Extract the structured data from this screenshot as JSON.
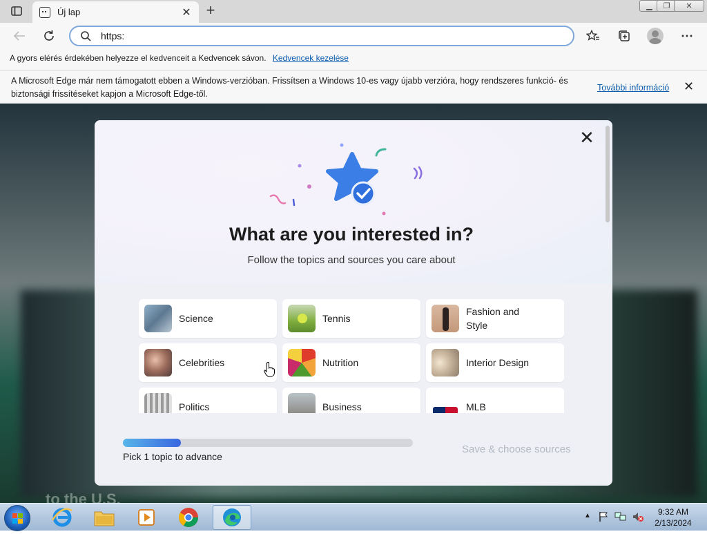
{
  "browser": {
    "tab_title": "Új lap",
    "address_value": "https:",
    "favorites_bar": {
      "text": "A gyors elérés érdekében helyezze el kedvenceit a Kedvencek sávon.",
      "link": "Kedvencek kezelése"
    },
    "infobar": {
      "message": "A Microsoft Edge már nem támogatott ebben a Windows-verzióban. Frissítsen a Windows 10-es vagy újabb verzióra, hogy rendszeres funkció- és biztonsági frissítéseket kapjon a Microsoft Edge-től.",
      "link": "További információ"
    }
  },
  "background_text": "to the U.S.",
  "dialog": {
    "title": "What are you interested in?",
    "subtitle": "Follow the topics and sources you care about",
    "topics": [
      {
        "label": "Science",
        "icon": "science-thumbnail"
      },
      {
        "label": "Tennis",
        "icon": "tennis-thumbnail"
      },
      {
        "label": "Fashion and Style",
        "icon": "fashion-thumbnail"
      },
      {
        "label": "Celebrities",
        "icon": "celebrities-thumbnail"
      },
      {
        "label": "Nutrition",
        "icon": "nutrition-thumbnail"
      },
      {
        "label": "Interior Design",
        "icon": "interior-design-thumbnail"
      },
      {
        "label": "Politics",
        "icon": "politics-thumbnail"
      },
      {
        "label": "Business",
        "icon": "business-thumbnail"
      },
      {
        "label": "MLB",
        "icon": "mlb-logo-thumbnail"
      }
    ],
    "progress": {
      "fraction": 0.2,
      "label": "Pick 1 topic to advance"
    },
    "save_button": "Save & choose sources"
  },
  "taskbar": {
    "items": [
      "internet-explorer-icon",
      "file-explorer-icon",
      "media-player-icon",
      "chrome-icon",
      "edge-icon"
    ],
    "active_item": "edge-icon",
    "clock": {
      "time": "9:32 AM",
      "date": "2/13/2024"
    }
  },
  "colors": {
    "accent": "#3a66e0",
    "link": "#0b5cad"
  }
}
